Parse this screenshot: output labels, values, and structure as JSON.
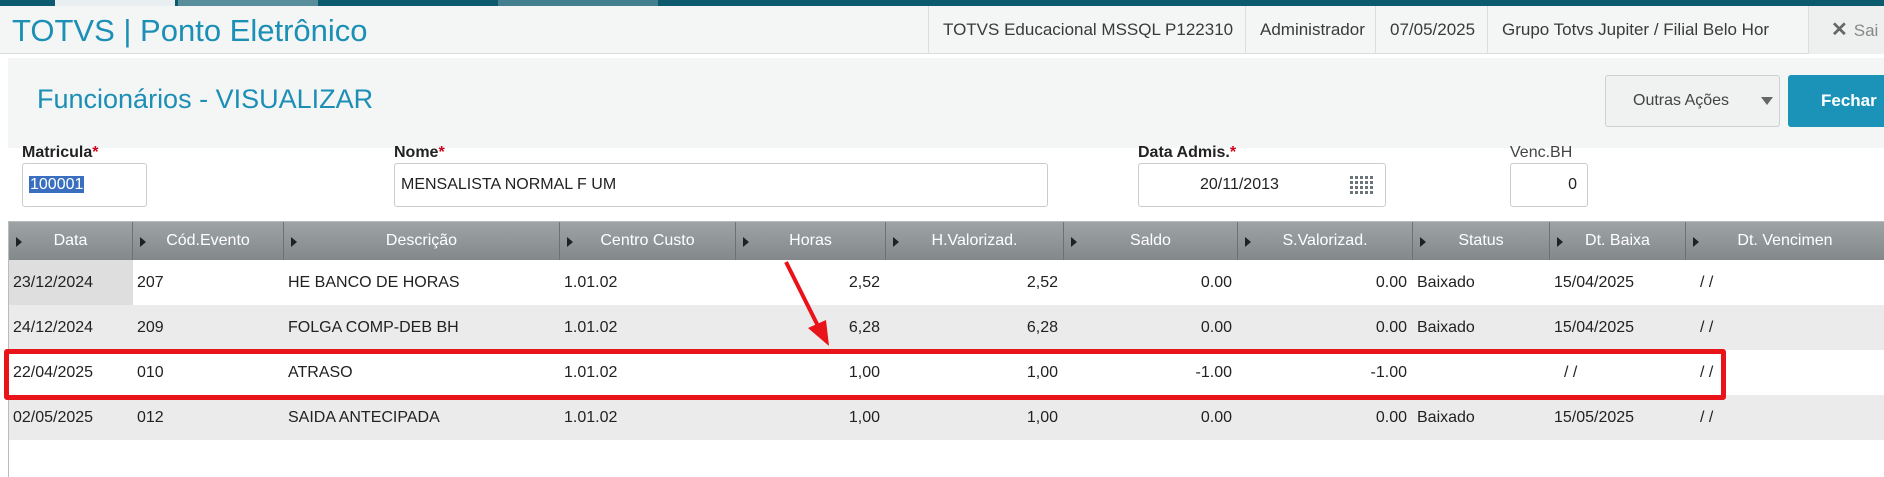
{
  "header": {
    "app_title": "TOTVS | Ponto Eletrônico",
    "environment": "TOTVS Educacional MSSQL P122310",
    "user": "Administrador",
    "date": "07/05/2025",
    "company": "Grupo Totvs Jupiter / Filial Belo Hor",
    "exit_label": "Sai"
  },
  "page": {
    "title": "Funcionários - VISUALIZAR",
    "other_actions_label": "Outras Ações",
    "close_label": "Fechar"
  },
  "form": {
    "matricula": {
      "label": "Matricula",
      "value": "100001"
    },
    "nome": {
      "label": "Nome",
      "value": "MENSALISTA NORMAL F UM"
    },
    "data_admis": {
      "label": "Data Admis.",
      "value": "20/11/2013"
    },
    "venc_bh": {
      "label": "Venc.BH",
      "value": "0"
    }
  },
  "grid": {
    "columns": [
      "Data",
      "Cód.Evento",
      "Descrição",
      "Centro Custo",
      "Horas",
      "H.Valorizad.",
      "Saldo",
      "S.Valorizad.",
      "Status",
      "Dt. Baixa",
      "Dt. Vencimen"
    ],
    "rows": [
      [
        "23/12/2024",
        "207",
        "HE BANCO DE HORAS",
        "1.01.02",
        "2,52",
        "2,52",
        "0.00",
        "0.00",
        "Baixado",
        "15/04/2025",
        " /  /"
      ],
      [
        "24/12/2024",
        "209",
        "FOLGA COMP-DEB BH",
        "1.01.02",
        "6,28",
        "6,28",
        "0.00",
        "0.00",
        "Baixado",
        "15/04/2025",
        " /  /"
      ],
      [
        "22/04/2025",
        "010",
        "ATRASO",
        "1.01.02",
        "1,00",
        "1,00",
        "-1.00",
        "-1.00",
        "",
        " /  /",
        " /  /"
      ],
      [
        "02/05/2025",
        "012",
        "SAIDA ANTECIPADA",
        "1.01.02",
        "1,00",
        "1,00",
        "0.00",
        "0.00",
        "Baixado",
        "15/05/2025",
        " /  /"
      ]
    ]
  },
  "colors": {
    "brand": "#1b8fb6",
    "annotation": "#e8141a",
    "header_grid": "#8f9597"
  }
}
